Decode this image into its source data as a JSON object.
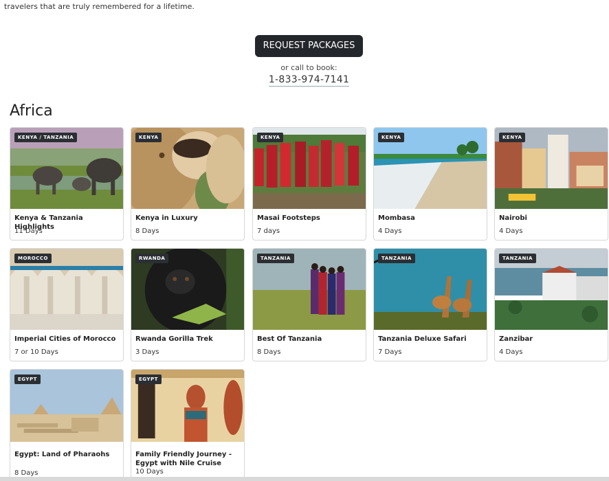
{
  "intro": {
    "text": "travelers that are truly remembered for a lifetime."
  },
  "cta": {
    "request_label": "REQUEST PACKAGES",
    "or_call": "or call to book:",
    "phone": "1-833-974-7141"
  },
  "region": {
    "title": "Africa"
  },
  "packages": [
    {
      "badge": "KENYA / TANZANIA",
      "name": "Kenya & Tanzania Highlights",
      "days": "11 Days",
      "image": "elephants"
    },
    {
      "badge": "KENYA",
      "name": "Kenya in Luxury",
      "days": "8 Days",
      "image": "lion"
    },
    {
      "badge": "KENYA",
      "name": "Masai Footsteps",
      "days": "7 days",
      "image": "masai"
    },
    {
      "badge": "KENYA",
      "name": "Mombasa",
      "days": "4 Days",
      "image": "beach"
    },
    {
      "badge": "KENYA",
      "name": "Nairobi",
      "days": "4 Days",
      "image": "city"
    },
    {
      "badge": "MOROCCO",
      "name": "Imperial Cities of Morocco",
      "days": "7 or 10 Days",
      "image": "arches"
    },
    {
      "badge": "RWANDA",
      "name": "Rwanda Gorilla Trek",
      "days": "3 Days",
      "image": "gorilla"
    },
    {
      "badge": "TANZANIA",
      "name": "Best Of Tanzania",
      "days": "8 Days",
      "image": "tribe"
    },
    {
      "badge": "TANZANIA",
      "name": "Tanzania Deluxe Safari",
      "days": "7 Days",
      "image": "giraffes"
    },
    {
      "badge": "TANZANIA",
      "name": "Zanzibar",
      "days": "4 Days",
      "image": "harbor"
    },
    {
      "badge": "EGYPT",
      "name": "Egypt: Land of Pharaohs",
      "days": "8 Days",
      "image": "pyramids"
    },
    {
      "badge": "EGYPT",
      "name": "Family Friendly Journey - Egypt with Nile Cruise",
      "days": "10 Days",
      "image": "pharaoh"
    }
  ],
  "colors": {
    "button": "#23272b",
    "badge": "#2b2f33",
    "card_border": "#d6d6d6"
  }
}
